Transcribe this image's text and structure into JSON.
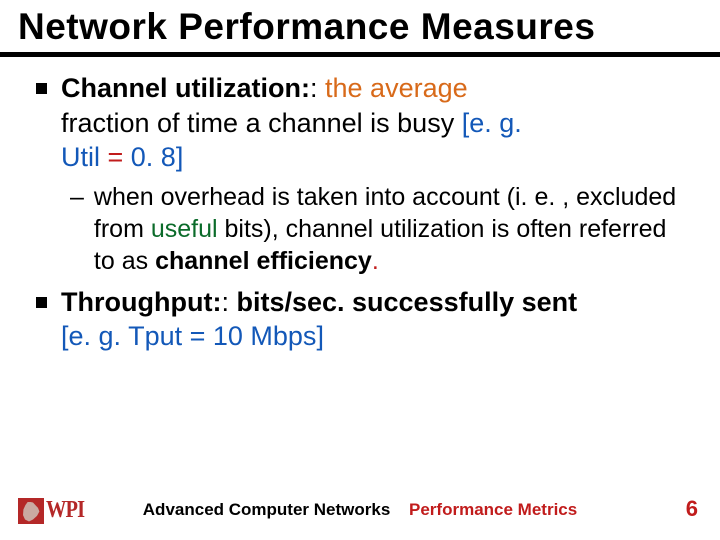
{
  "title": "Network Performance Measures",
  "body": {
    "b1_term": "Channel utilization:",
    "b1_colon2": ":",
    "b1_rest_orange": " the average",
    "b1_line2_a": "fraction of time a channel is busy ",
    "b1_eg_open": "[",
    "b1_eg_prefix": "e. g.",
    "b1_eg_mid_a": "Util ",
    "b1_eg_eq": "=",
    "b1_eg_mid_b": " 0. 8",
    "b1_eg_close": "]",
    "sub1_a": "when overhead is taken into account (i. e. , excluded from ",
    "sub1_useful": "useful",
    "sub1_b": " bits), channel utilization is often referred to as ",
    "sub1_eff": "channel efficiency",
    "sub1_period": ".",
    "b2_term": "Throughput:",
    "b2_colon2": ":",
    "b2_rest": " bits/sec. successfully sent",
    "b2_eg_open": "[",
    "b2_eg_prefix": "e. g.",
    "b2_eg_mid": " Tput = 10 Mbps",
    "b2_eg_close": "]"
  },
  "footer": {
    "logo_text": "WPI",
    "course": "Advanced Computer Networks",
    "topic": "Performance Metrics",
    "page": "6"
  }
}
